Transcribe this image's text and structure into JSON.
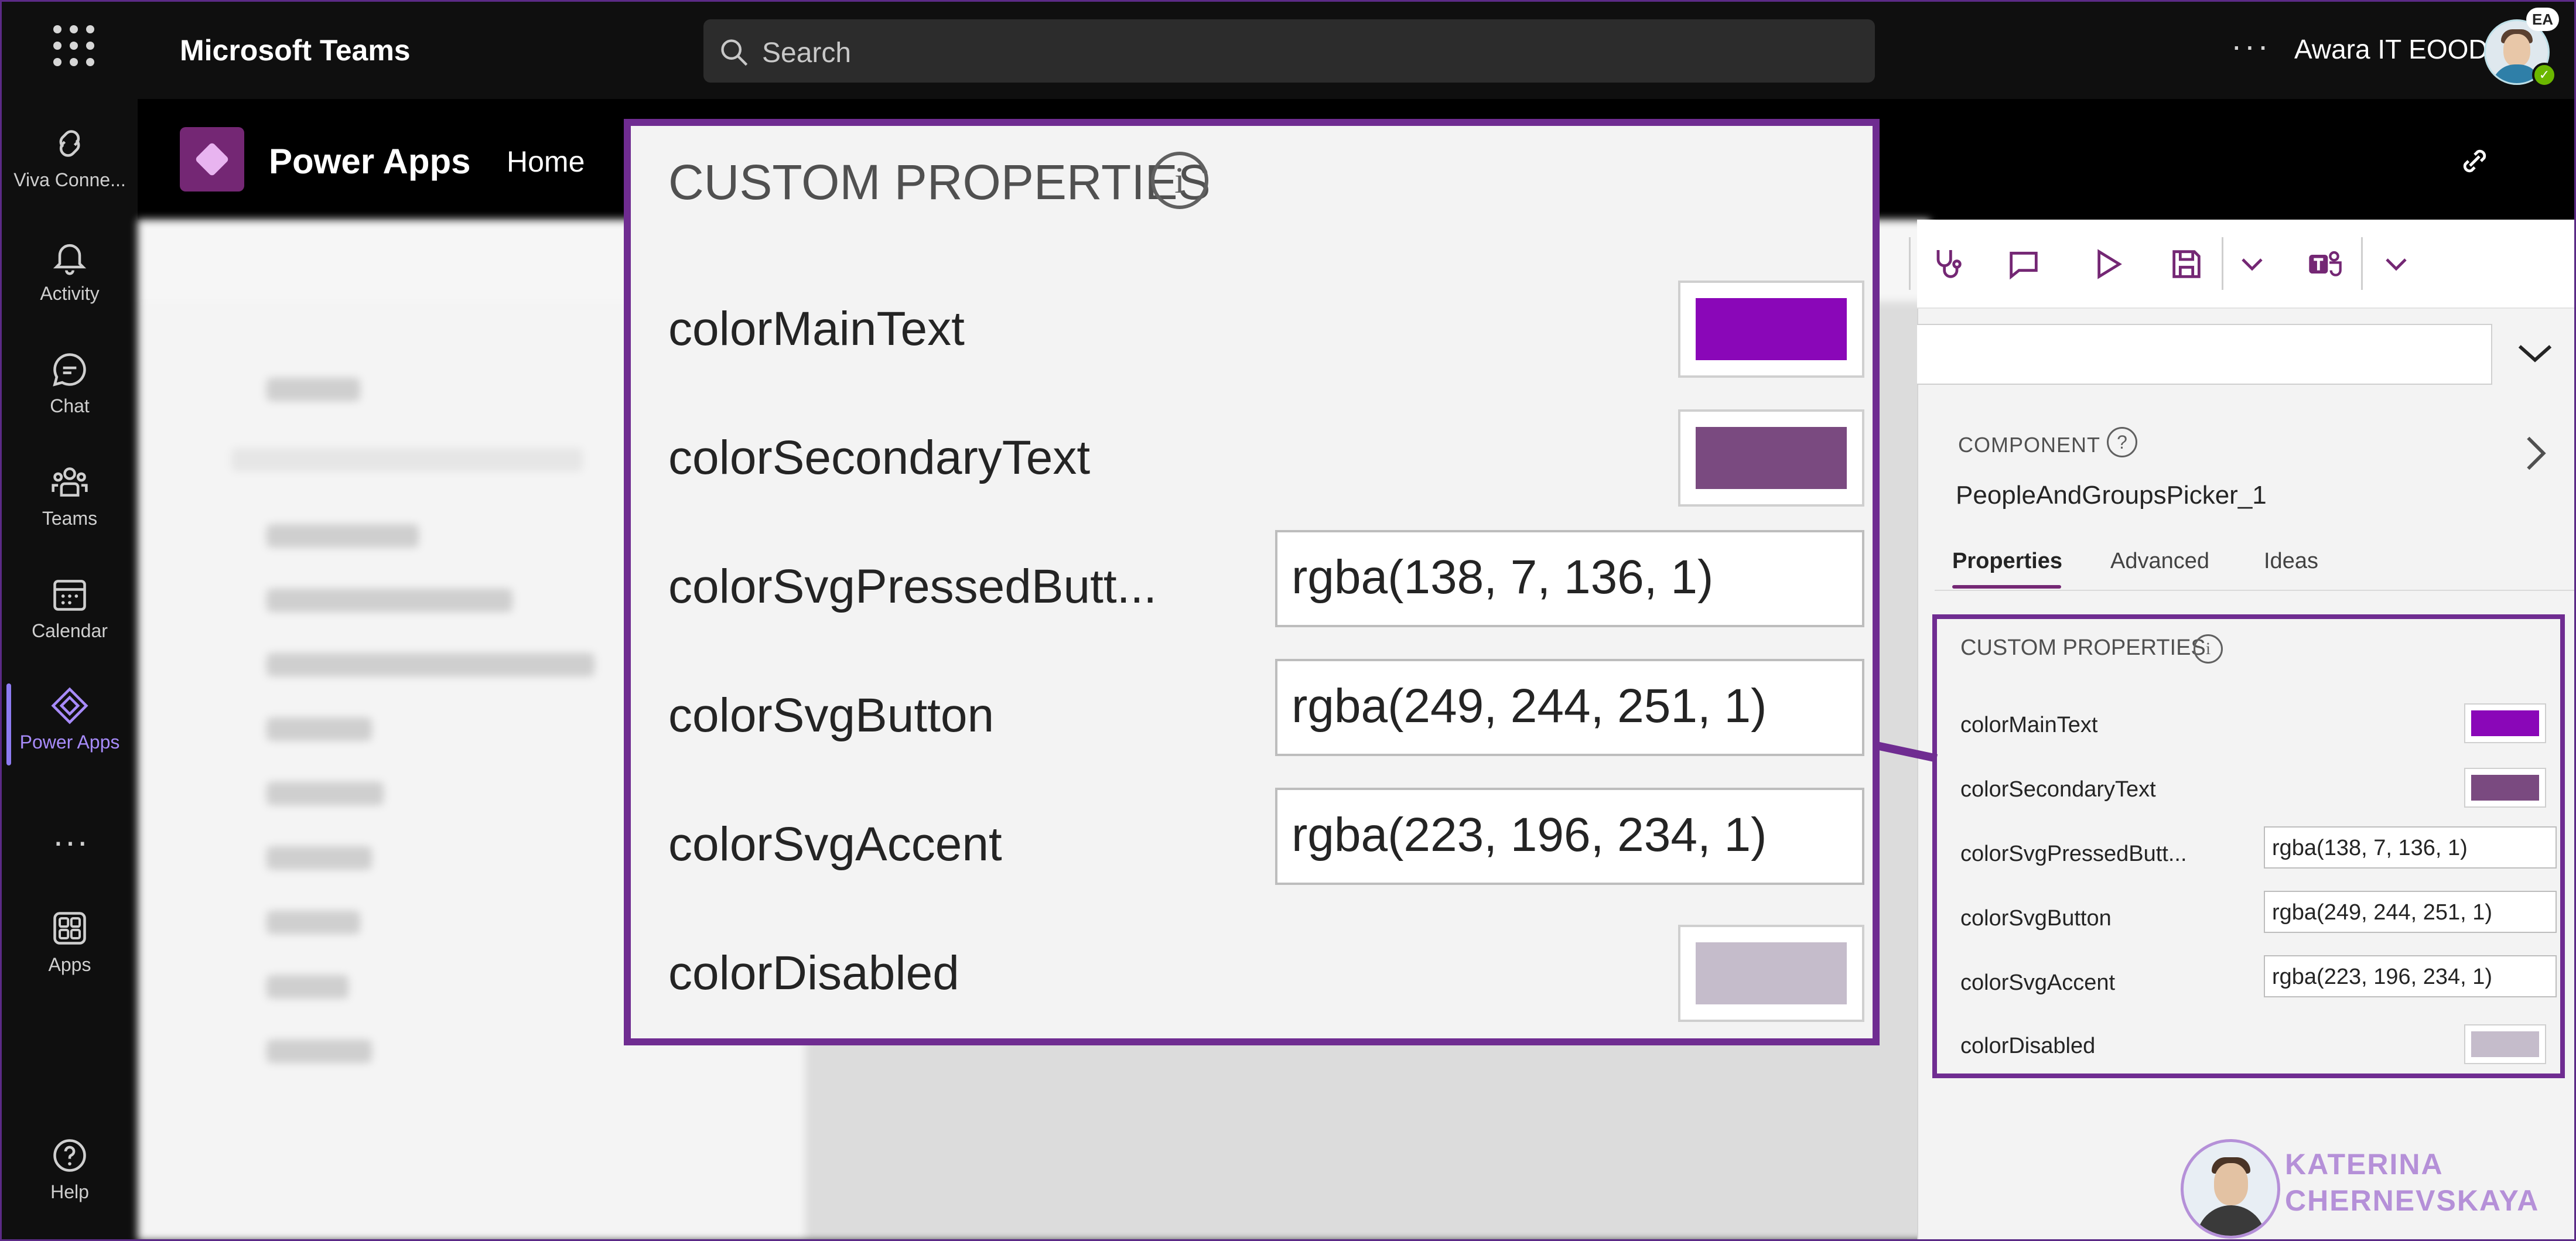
{
  "teams": {
    "app_title": "Microsoft Teams",
    "search_placeholder": "Search",
    "org_name": "Awara IT EOOD",
    "user_initials": "EA"
  },
  "rail": {
    "items": [
      {
        "label": "Viva Conne...",
        "icon": "viva-connections-icon"
      },
      {
        "label": "Activity",
        "icon": "bell-icon"
      },
      {
        "label": "Chat",
        "icon": "chat-icon"
      },
      {
        "label": "Teams",
        "icon": "teams-icon"
      },
      {
        "label": "Calendar",
        "icon": "calendar-icon"
      },
      {
        "label": "Power Apps",
        "icon": "power-apps-icon",
        "active": true
      },
      {
        "label": "Apps",
        "icon": "apps-icon"
      },
      {
        "label": "Help",
        "icon": "help-icon"
      }
    ],
    "more": "..."
  },
  "powerapps": {
    "title": "Power Apps",
    "nav_home": "Home"
  },
  "panel": {
    "component_label": "COMPONENT",
    "component_name": "PeopleAndGroupsPicker_1",
    "tabs": [
      "Properties",
      "Advanced",
      "Ideas"
    ],
    "selected_tab": "Properties"
  },
  "custom_properties": {
    "header": "CUSTOM PROPERTIES",
    "rows": [
      {
        "label": "colorMainText",
        "kind": "swatch",
        "color": "#8a07b8"
      },
      {
        "label": "colorSecondaryText",
        "kind": "swatch",
        "color": "#7a4a80"
      },
      {
        "label": "colorSvgPressedButt...",
        "kind": "text",
        "value": "rgba(138, 7, 136, 1)"
      },
      {
        "label": "colorSvgButton",
        "kind": "text",
        "value": "rgba(249, 244, 251, 1)"
      },
      {
        "label": "colorSvgAccent",
        "kind": "text",
        "value": "rgba(223, 196, 234, 1)"
      },
      {
        "label": "colorDisabled",
        "kind": "swatch",
        "color": "#c5bccb"
      }
    ]
  },
  "colors": {
    "accent_purple": "#6f2c91",
    "powerapps_brand": "#742774"
  },
  "watermark": {
    "line1": "KATERINA",
    "line2": "CHERNEVSKAYA"
  }
}
